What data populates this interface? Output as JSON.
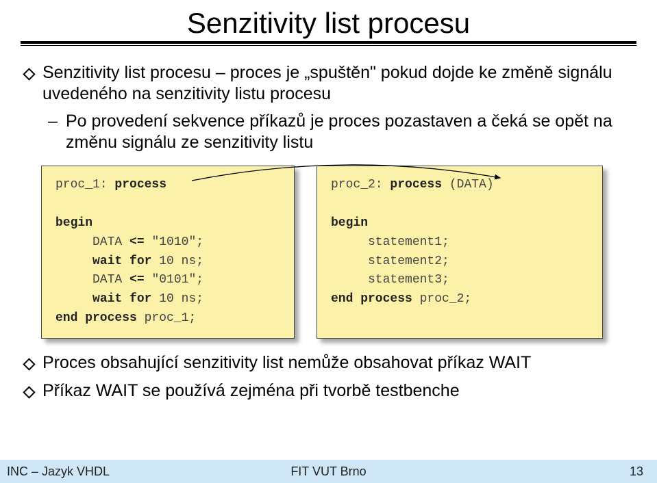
{
  "title": "Senzitivity list procesu",
  "bullet1": "Senzitivity list  procesu – proces je „spuštěn\" pokud dojde ke změně signálu uvedeného na senzitivity listu procesu",
  "sub1": "Po provedení sekvence příkazů je proces pozastaven a čeká se opět na změnu signálu ze senzitivity listu",
  "code_left": {
    "l1a": "proc_1: ",
    "l1b": "process",
    "l2": "begin",
    "l3a": "     DATA ",
    "l3b": "<=",
    "l3c": " \"1010\";",
    "l4a": "     ",
    "l4b": "wait for ",
    "l4c": "10 ns;",
    "l5a": "     DATA ",
    "l5b": "<=",
    "l5c": " \"0101\";",
    "l6a": "     ",
    "l6b": "wait for ",
    "l6c": "10 ns;",
    "l7a": "end process ",
    "l7b": "proc_1;"
  },
  "code_right": {
    "l1a": "proc_2: ",
    "l1b": "process ",
    "l1c": "(DATA)",
    "l2": "begin",
    "l3": "     statement1;",
    "l4": "     statement2;",
    "l5": "     statement3;",
    "l6a": "end process ",
    "l6b": "proc_2;"
  },
  "bullet2": "Proces obsahující senzitivity list nemůže obsahovat příkaz WAIT",
  "bullet3": "Příkaz WAIT se používá zejména při tvorbě testbenche",
  "footer": {
    "left": "INC – Jazyk VHDL",
    "center": "FIT VUT Brno",
    "right": "13"
  }
}
